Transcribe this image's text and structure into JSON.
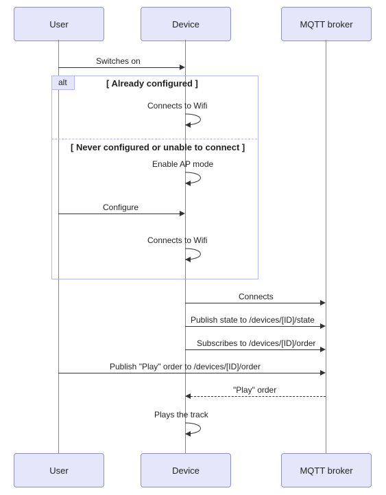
{
  "actors": {
    "user": "User",
    "device": "Device",
    "broker": "MQTT broker"
  },
  "msgs": {
    "switches_on": "Switches on",
    "connects_wifi": "Connects to Wifi",
    "enable_ap": "Enable AP mode",
    "configure": "Configure",
    "connects_wifi2": "Connects to Wifi",
    "connects": "Connects",
    "pub_state": "Publish state to /devices/[ID]/state",
    "subscribes": "Subscribes to /devices/[ID]/order",
    "pub_play": "Publish \"Play\" order to /devices/[ID]/order",
    "play_order": "\"Play\" order",
    "plays_track": "Plays the track"
  },
  "alt": {
    "tag": "alt",
    "branch1": "[ Already configured ]",
    "branch2": "[ Never configured or unable to connect ]"
  },
  "chart_data": {
    "type": "sequence-diagram",
    "participants": [
      "User",
      "Device",
      "MQTT broker"
    ],
    "messages": [
      {
        "from": "User",
        "to": "Device",
        "label": "Switches on",
        "kind": "solid"
      },
      {
        "frame": "alt",
        "branches": [
          {
            "guard": "Already configured",
            "messages": [
              {
                "from": "Device",
                "to": "Device",
                "label": "Connects to Wifi",
                "kind": "self"
              }
            ]
          },
          {
            "guard": "Never configured or unable to connect",
            "messages": [
              {
                "from": "Device",
                "to": "Device",
                "label": "Enable AP mode",
                "kind": "self"
              },
              {
                "from": "User",
                "to": "Device",
                "label": "Configure",
                "kind": "solid"
              },
              {
                "from": "Device",
                "to": "Device",
                "label": "Connects to Wifi",
                "kind": "self"
              }
            ]
          }
        ]
      },
      {
        "from": "Device",
        "to": "MQTT broker",
        "label": "Connects",
        "kind": "solid"
      },
      {
        "from": "Device",
        "to": "MQTT broker",
        "label": "Publish state to /devices/[ID]/state",
        "kind": "solid"
      },
      {
        "from": "Device",
        "to": "MQTT broker",
        "label": "Subscribes to /devices/[ID]/order",
        "kind": "solid"
      },
      {
        "from": "User",
        "to": "MQTT broker",
        "label": "Publish \"Play\" order to /devices/[ID]/order",
        "kind": "solid"
      },
      {
        "from": "MQTT broker",
        "to": "Device",
        "label": "\"Play\" order",
        "kind": "dashed"
      },
      {
        "from": "Device",
        "to": "Device",
        "label": "Plays the track",
        "kind": "self"
      }
    ]
  }
}
